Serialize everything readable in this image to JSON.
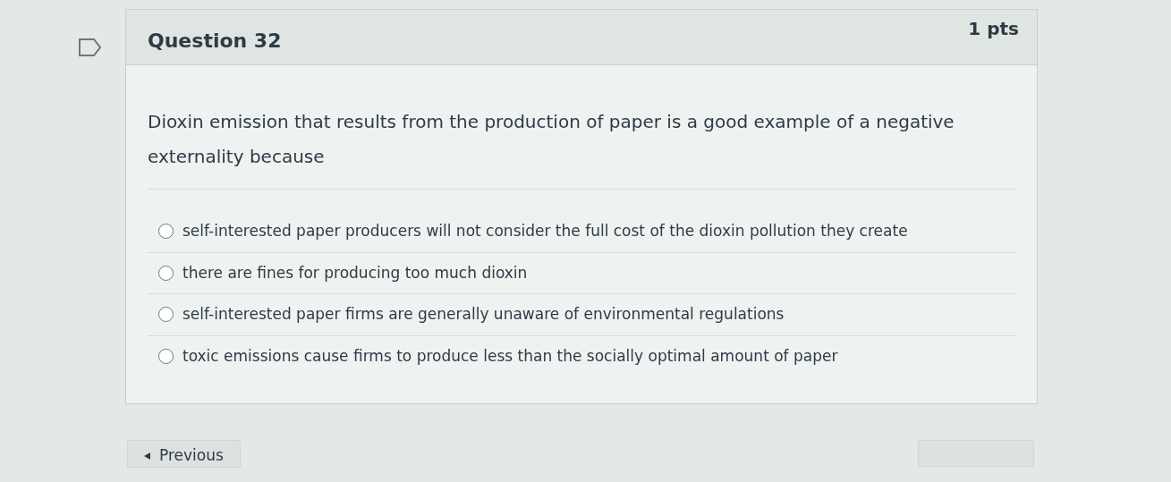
{
  "question": {
    "flagged": false,
    "title": "Question 32",
    "points": "1 pts",
    "text": "Dioxin emission that results from the production of paper is a good example of a negative externality because",
    "answers": [
      {
        "label": "self-interested paper producers will not consider the full cost of the dioxin pollution they create",
        "selected": false
      },
      {
        "label": "there are fines for producing too much dioxin",
        "selected": false
      },
      {
        "label": "self-interested paper firms are generally unaware of environmental regulations",
        "selected": false
      },
      {
        "label": "toxic emissions cause firms to produce less than the socially optimal amount of paper",
        "selected": false
      }
    ]
  },
  "navigation": {
    "previous": "Previous"
  }
}
